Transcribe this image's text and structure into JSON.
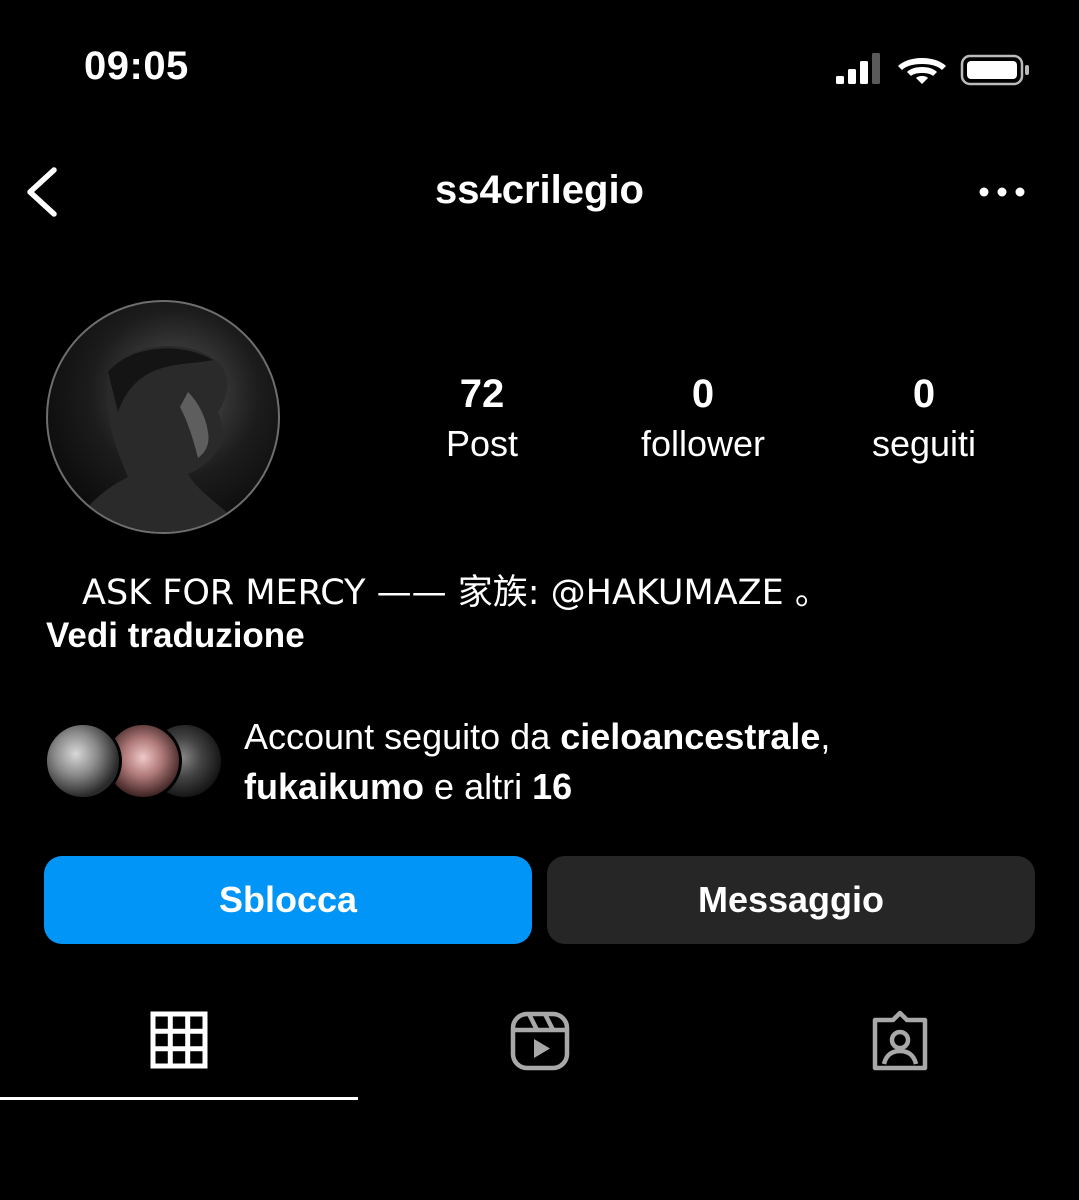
{
  "status_bar": {
    "time": "09:05",
    "icons": [
      "cellular-signal-icon",
      "wifi-icon",
      "battery-icon"
    ]
  },
  "header": {
    "username": "ss4crilegio",
    "back_icon": "chevron-left-icon",
    "more_icon": "more-horizontal-icon"
  },
  "profile": {
    "stats": [
      {
        "value": "72",
        "label": "Post"
      },
      {
        "value": "0",
        "label": "follower"
      },
      {
        "value": "0",
        "label": "seguiti"
      }
    ],
    "bio": "ASK FOR MERCY —— 家族: @HAKUMAZE 。",
    "translate_link": "Vedi traduzione"
  },
  "followed_by": {
    "prefix": "Account seguito da ",
    "user1": "cieloancestrale",
    "separator": ",",
    "user2": "fukaikumo",
    "middle": " e altri ",
    "count": "16"
  },
  "actions": {
    "unblock_label": "Sblocca",
    "message_label": "Messaggio",
    "unblock_color": "#0095f6",
    "message_color": "#262626"
  },
  "tabs": [
    {
      "icon": "grid-icon",
      "active": true
    },
    {
      "icon": "reels-icon",
      "active": false
    },
    {
      "icon": "tagged-icon",
      "active": false
    }
  ]
}
